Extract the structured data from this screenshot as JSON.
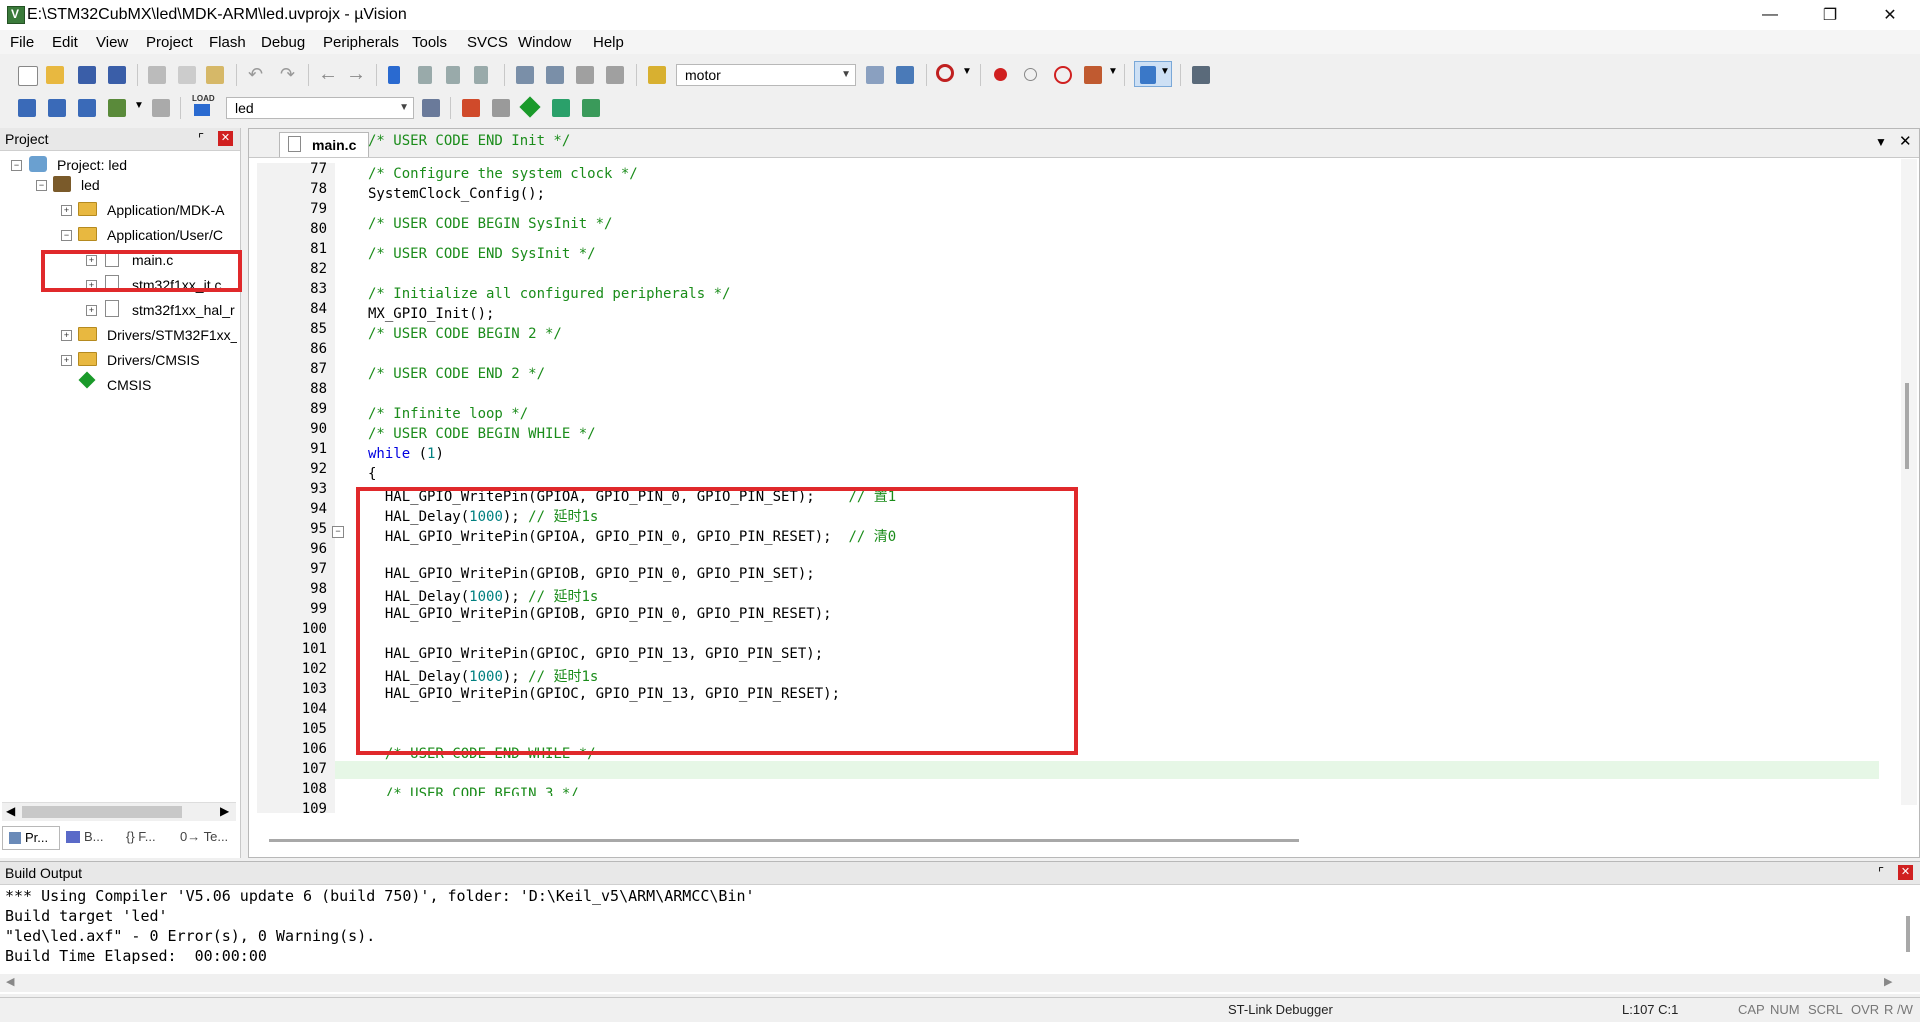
{
  "window": {
    "title": "E:\\STM32CubMX\\led\\MDK-ARM\\led.uvprojx - µVision"
  },
  "menu": [
    "File",
    "Edit",
    "View",
    "Project",
    "Flash",
    "Debug",
    "Peripherals",
    "Tools",
    "SVCS",
    "Window",
    "Help"
  ],
  "toolbar": {
    "target_combo": "motor",
    "build_combo": "led",
    "load_label": "LOAD"
  },
  "project_panel": {
    "header": "Project",
    "tree": [
      {
        "label": "Project: led"
      },
      {
        "label": "led"
      },
      {
        "label": "Application/MDK-A"
      },
      {
        "label": "Application/User/C"
      },
      {
        "label": "main.c"
      },
      {
        "label": "stm32f1xx_it.c"
      },
      {
        "label": "stm32f1xx_hal_r"
      },
      {
        "label": "Drivers/STM32F1xx_"
      },
      {
        "label": "Drivers/CMSIS"
      },
      {
        "label": "CMSIS"
      }
    ],
    "bottom_tabs": [
      "Pr...",
      "B...",
      "{} F...",
      "0→ Te..."
    ]
  },
  "editor": {
    "tab": "main.c",
    "line_numbers": [
      "77",
      "78",
      "79",
      "80",
      "81",
      "82",
      "83",
      "84",
      "85",
      "86",
      "87",
      "88",
      "89",
      "90",
      "91",
      "92",
      "93",
      "94",
      "95",
      "96",
      "97",
      "98",
      "99",
      "100",
      "101",
      "102",
      "103",
      "104",
      "105",
      "106",
      "107",
      "108",
      "109"
    ],
    "lines": {
      "l77": "/* USER CODE END Init */",
      "l79": "/* Configure the system clock */",
      "l80": "SystemClock_Config();",
      "l82": "/* USER CODE BEGIN SysInit */",
      "l84": "/* USER CODE END SysInit */",
      "l86": "/* Initialize all configured peripherals */",
      "l87": "MX_GPIO_Init();",
      "l88": "/* USER CODE BEGIN 2 */",
      "l90": "/* USER CODE END 2 */",
      "l92": "/* Infinite loop */",
      "l93": "/* USER CODE BEGIN WHILE */",
      "l94_kw": "while",
      "l94_a": " (",
      "l94_num": "1",
      "l94_b": ")",
      "l95": "{",
      "l96_code": "  HAL_GPIO_WritePin(GPIOA, GPIO_PIN_0, GPIO_PIN_SET);    ",
      "l96_cmt": "// 置1",
      "l97_a": "  HAL_Delay(",
      "l97_num": "1000",
      "l97_b": "); ",
      "l97_cmt": "// 延时1s",
      "l98_code": "  HAL_GPIO_WritePin(GPIOA, GPIO_PIN_0, GPIO_PIN_RESET);  ",
      "l98_cmt": "// 清0",
      "l100": "  HAL_GPIO_WritePin(GPIOB, GPIO_PIN_0, GPIO_PIN_SET);",
      "l101_a": "  HAL_Delay(",
      "l101_num": "1000",
      "l101_b": "); ",
      "l101_cmt": "// 延时1s",
      "l102": "  HAL_GPIO_WritePin(GPIOB, GPIO_PIN_0, GPIO_PIN_RESET);",
      "l104": "  HAL_GPIO_WritePin(GPIOC, GPIO_PIN_13, GPIO_PIN_SET);",
      "l105_a": "  HAL_Delay(",
      "l105_num": "1000",
      "l105_b": "); ",
      "l105_cmt": "// 延时1s",
      "l106": "  HAL_GPIO_WritePin(GPIOC, GPIO_PIN_13, GPIO_PIN_RESET);",
      "l108": "  /* USER CODE END WHILE */",
      "l110": "  /* USER CODE BEGIN 3 */"
    }
  },
  "build_output": {
    "header": "Build Output",
    "lines": [
      "*** Using Compiler 'V5.06 update 6 (build 750)', folder: 'D:\\Keil_v5\\ARM\\ARMCC\\Bin'",
      "Build target 'led'",
      "\"led\\led.axf\" - 0 Error(s), 0 Warning(s).",
      "Build Time Elapsed:  00:00:00"
    ]
  },
  "status": {
    "debugger": "ST-Link Debugger",
    "position": "L:107 C:1",
    "caps": "CAP",
    "num": "NUM",
    "scrl": "SCRL",
    "ovr": "OVR",
    "rw": "R /W"
  },
  "colors": {
    "highlight_box": "#e0292b",
    "comment": "#1a8c1a",
    "keyword": "#0000e0",
    "number": "#008080",
    "current_line": "#e6f7e6"
  }
}
